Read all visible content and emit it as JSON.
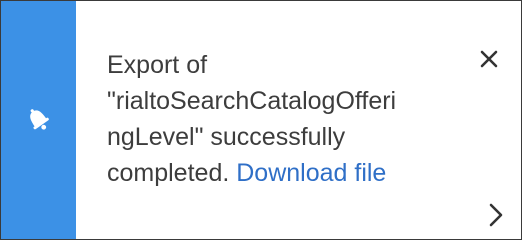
{
  "notification": {
    "icon": "bell-icon",
    "accent_color": "#3c91e6",
    "message": "Export of\n\"rialtoSearchCatalogOfferi\nngLevel\" successfully\ncompleted. ",
    "link_label": "Download file",
    "link_color": "#2f6fc7",
    "close_icon": "close-icon",
    "next_icon": "chevron-right-icon"
  }
}
